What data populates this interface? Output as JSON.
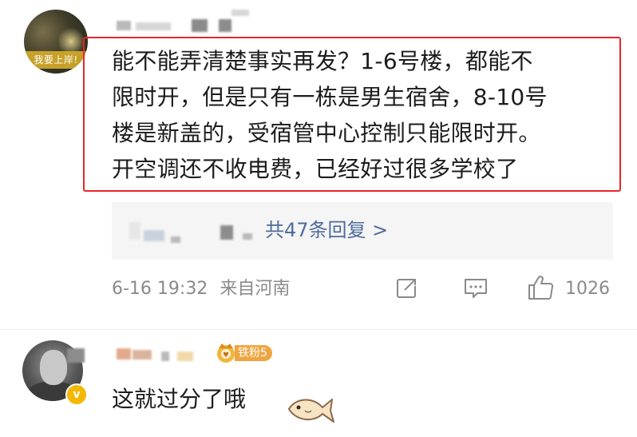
{
  "comment1": {
    "avatar_banner": "我要上岸!",
    "text_lines": [
      "能不能弄清楚事实再发？1-6号楼，都能不",
      "限时开，但是只有一栋是男生宿舍，8-10号",
      "楼是新盖的，受宿管中心控制只能限时开。",
      "开空调还不收电费，已经好过很多学校了"
    ],
    "replies_link": "共47条回复 >",
    "timestamp": "6-16 19:32",
    "source": "来自河南",
    "like_count": "1026"
  },
  "comment2": {
    "fan_badge": "铁粉5",
    "text": "这就过分了哦",
    "verified_badge": "v"
  },
  "colors": {
    "highlight_border": "#e8262a",
    "link": "#4e6b9c",
    "meta_gray": "#8a8a8a",
    "fan_badge": "#f0a640",
    "verified": "#f5b800"
  },
  "icons": {
    "share": "share-icon",
    "comment": "comment-icon",
    "like": "thumbs-up-icon",
    "fan": "crown-badge-icon",
    "emoji": "fish-emoji-icon"
  }
}
